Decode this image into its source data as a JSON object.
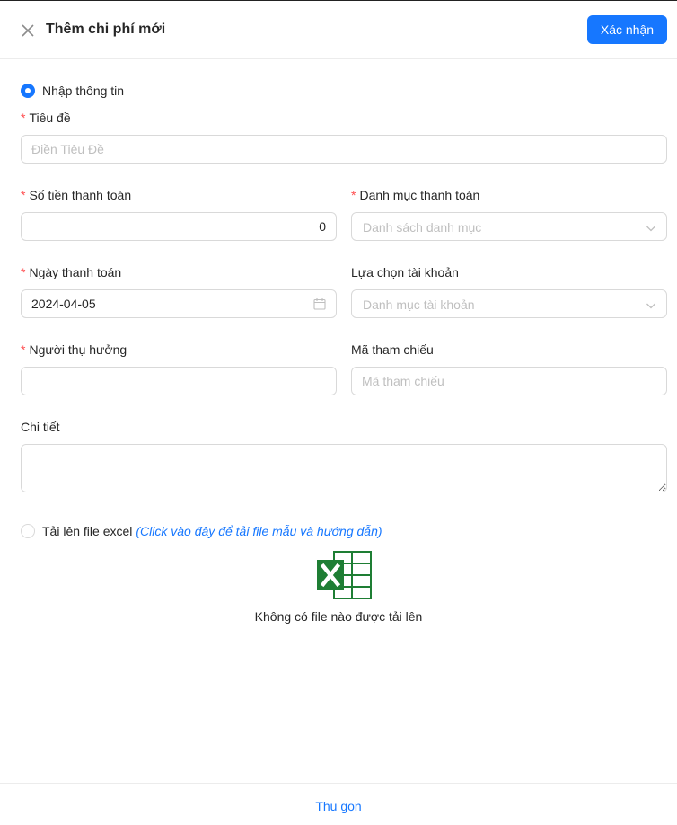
{
  "header": {
    "title": "Thêm chi phí mới",
    "confirm_label": "Xác nhận"
  },
  "mode_manual": {
    "label": "Nhập thông tin",
    "selected": true
  },
  "fields": {
    "title": {
      "label": "Tiêu đề",
      "required": "*",
      "placeholder": "Điền Tiêu Đề",
      "value": ""
    },
    "amount": {
      "label": "Số tiền thanh toán",
      "required": "*",
      "value": "0"
    },
    "category": {
      "label": "Danh mục thanh toán",
      "required": "*",
      "placeholder": "Danh sách danh mục"
    },
    "date": {
      "label": "Ngày thanh toán",
      "required": "*",
      "value": "2024-04-05"
    },
    "account": {
      "label": "Lựa chọn tài khoản",
      "placeholder": "Danh mục tài khoản"
    },
    "beneficiary": {
      "label": "Người thụ hưởng",
      "required": "*",
      "value": ""
    },
    "reference": {
      "label": "Mã tham chiếu",
      "placeholder": "Mã tham chiếu",
      "value": ""
    },
    "details": {
      "label": "Chi tiết",
      "value": ""
    }
  },
  "mode_upload": {
    "label": "Tải lên file excel",
    "link_text": "(Click vào đây để tải file mẫu và hướng dẫn)",
    "selected": false,
    "empty_text": "Không có file nào được tải lên"
  },
  "footer": {
    "collapse_label": "Thu gọn"
  },
  "colors": {
    "primary": "#1677ff",
    "required": "#ff4d4f",
    "excel": "#1e7e34"
  },
  "icons": {
    "close": "close-icon",
    "chevron": "chevron-down-icon",
    "calendar": "calendar-icon",
    "excel": "excel-file-icon"
  }
}
